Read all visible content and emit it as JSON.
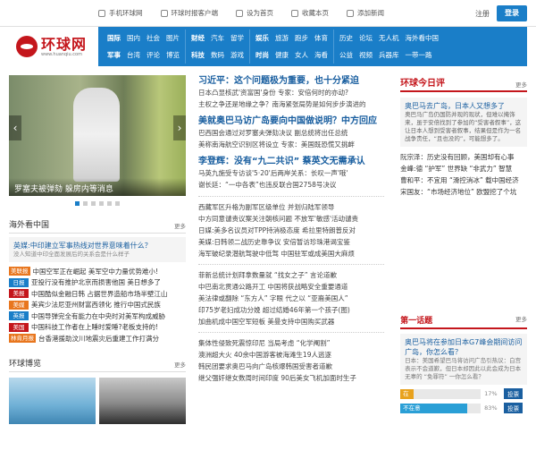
{
  "topbar": {
    "links": [
      {
        "icon": "mobile-icon",
        "label": "手机环球网"
      },
      {
        "icon": "phone-client-icon",
        "label": "环球时报客户端"
      },
      {
        "icon": "home-icon",
        "label": "设为首页"
      },
      {
        "icon": "star-icon",
        "label": "收藏本页"
      },
      {
        "icon": "plus-icon",
        "label": "添加新闻"
      }
    ],
    "register": "注册",
    "login": "登录"
  },
  "logo": {
    "name": "环球网",
    "url": "www.huanqiu.com"
  },
  "nav": {
    "groups": [
      {
        "rows": [
          [
            "国际",
            "国内",
            "社会",
            "图片"
          ],
          [
            "军事",
            "台湾",
            "评论",
            "博览"
          ]
        ]
      },
      {
        "rows": [
          [
            "财经",
            "汽车",
            "留学"
          ],
          [
            "科技",
            "数码",
            "游戏"
          ]
        ]
      },
      {
        "rows": [
          [
            "娱乐",
            "旅游",
            "跑步",
            "体育"
          ],
          [
            "时尚",
            "健康",
            "女人",
            "海看"
          ]
        ]
      },
      {
        "rows": [
          [
            "历史",
            "论坛",
            "无人机",
            "海外看中国"
          ],
          [
            "公益",
            "视频",
            "兵器库",
            "一带一路"
          ]
        ]
      }
    ]
  },
  "slideshow": {
    "caption": "罗塞夫被弹劾 躲房内等消息",
    "dots": 6,
    "active_dot": 0
  },
  "overseas": {
    "title": "海外看中国",
    "more": "更多",
    "lead_title": "英媒:中印建立军事热线对世界意味着什么？",
    "lead_sub": "没人知道中印全面发展后的关系会是什么样子",
    "items": [
      {
        "tag": "美联报",
        "color": "#e8761e",
        "text": "中国空军正在崛起 美军空中力量优势难小!"
      },
      {
        "tag": "日报",
        "color": "#1a7ec8",
        "text": "亚投行没有推护北京而损害他国 美日想多了"
      },
      {
        "tag": "美报",
        "color": "#c4161c",
        "text": "中国酷似金融日韩 占据世界造船市场半壁江山"
      },
      {
        "tag": "美媒",
        "color": "#e8761e",
        "text": "美宾少法尼亚州财富西领化 推行中国式民族"
      },
      {
        "tag": "英报",
        "color": "#1a7ec8",
        "text": "中国导弹完全有能力在中央时对美军构成威胁"
      },
      {
        "tag": "美国",
        "color": "#c4161c",
        "text": "中国科技工作者在上睡时爱睡?老板支持的!"
      },
      {
        "tag": "林肯月报",
        "color": "#e8761e",
        "text": "台香港援助汶川地震灾后重建工作打满分"
      }
    ]
  },
  "expo": {
    "title": "环球博览",
    "more": "更多"
  },
  "middle": {
    "top": {
      "headline": "习近平：这个问题极为重要，也十分紧迫",
      "subs": [
        "日本凸显核武'资富国'身份 专家：安倍何时的亦动?",
        "主权之争还是地缘之争？南海紧张局势是如何步步演进的"
      ]
    },
    "obama": {
      "headline": "美就奥巴马访广岛要向中国做说明？中方回应",
      "subs": [
        "巴西国会通过对罗塞夫弹劾决议 副总统将出任总统",
        "美称南海航空识别区将设立 专家：美国既恐慌又挑衅"
      ]
    },
    "tsai": {
      "headline": "李登辉：没有“九二共识” 蔡英文无需承认",
      "subs": [
        "马英九施受专访谈'5·20'后两岸关系：长叹一声'哦'",
        "谢长廷：“一中各表”也违反联合国2758号决议"
      ]
    },
    "list1": [
      "西藏军区升格为副军区级单位 并划归陆军领导",
      "中方同意谴责议案关注朝核问题 不放军'敏感'活动谴责",
      "日媒:美多名议员对TPP持消极态度 希拉里特朗普反对",
      "美媒:日韩领二战历史靠争议 安倍暂访珍珠港谒宝鉴",
      "海军破纪录潜航驾驶中低驾 中国驻军或成美国大麻烦"
    ],
    "list2": [
      "菲新总统计划拜拿数量就 “找女之子” 言论道歉",
      "中巴南北贯通公路开工 中国将获战略安全重要通道",
      "美法律或翻除 “东方人” 字眼 代之以 “亚裔美国人”",
      "印75岁老妇成功分娩 超过结婚46年第一个孩子(图)",
      "加曲机成中国空军短板 美曼支持中国购买武器"
    ],
    "list3": [
      "集体性侵致死震惊印尼 当局考虑 “化学阉割”",
      "澳洲超大火 40余中国游客被海滩生19人逃逐",
      "韩民团要求奥巴马向广岛核爆韩国受害者道歉",
      "继父强奸继女数周时间印度 90后美女飞机加面时生子"
    ]
  },
  "review": {
    "title": "环球今日评",
    "more": "更多",
    "lead_title": "奥巴马去广岛，日本人又想多了",
    "lead_sub": "奥巴马广岛仍国防并现的现状，但难以掩饰来，虽于安倍找到了参加的“受害者叙事”，这让日本人想到受害者叙事，结果但是作为一名战争责任，“且也没的”，可能想多了。",
    "items": [
      "阮宗泽：历史没有回顾，美国却有心事",
      "金峰:德 “护军” 世界缺 “非武力” 智慧",
      "曹和平：不宜用 “滑控消冰” 载中国经济",
      "宋国友：“市场经济地位” 欧盟挖了个坑"
    ]
  },
  "poll": {
    "title": "第一话题",
    "more": "更多",
    "question": "奥巴马将在参加日本G7峰会期间访问广岛，你怎么看？",
    "desc": "日本：美国希望巴马将访问广岛引热议：白宫表示不会道歉，但日本却因此以此会成为日本无辜的 “免罪符” 一你怎么看？",
    "options": [
      {
        "label": "在意",
        "pct": 17,
        "color": "#e8a21e",
        "vote": "投票"
      },
      {
        "label": "不在意",
        "pct": 83,
        "color": "#2a9fd6",
        "vote": "投票"
      }
    ]
  }
}
